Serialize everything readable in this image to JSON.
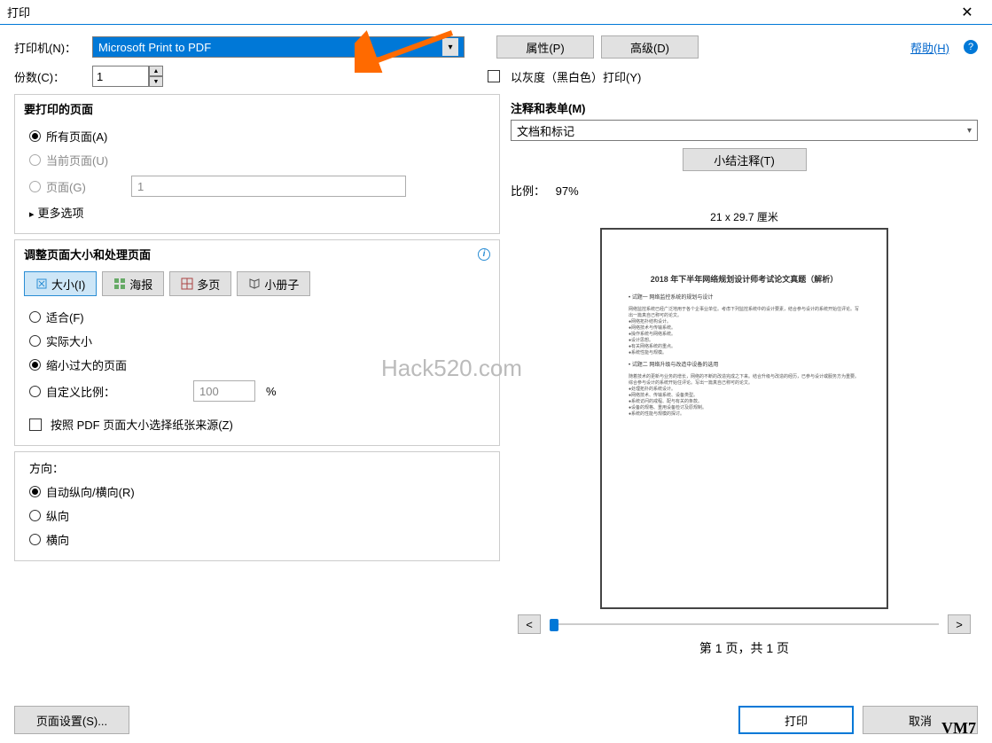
{
  "title": "打印",
  "printer": {
    "label": "打印机(N)：",
    "selected": "Microsoft Print to PDF",
    "properties_btn": "属性(P)",
    "advanced_btn": "高级(D)",
    "help_link": "帮助(H)"
  },
  "copies": {
    "label": "份数(C)：",
    "value": "1",
    "grayscale_label": "以灰度（黑白色）打印(Y)"
  },
  "pages_group": {
    "title": "要打印的页面",
    "all": "所有页面(A)",
    "current": "当前页面(U)",
    "pages": "页面(G)",
    "pages_value": "1",
    "more": "更多选项"
  },
  "sizing_group": {
    "title": "调整页面大小和处理页面",
    "tabs": {
      "size": "大小(I)",
      "poster": "海报",
      "multiple": "多页",
      "booklet": "小册子"
    },
    "fit": "适合(F)",
    "actual": "实际大小",
    "shrink": "缩小过大的页面",
    "custom": "自定义比例：",
    "custom_value": "100",
    "percent": "%",
    "paper_source": "按照 PDF 页面大小选择纸张来源(Z)"
  },
  "orientation_group": {
    "title": "方向：",
    "auto": "自动纵向/横向(R)",
    "portrait": "纵向",
    "landscape": "横向"
  },
  "comments_group": {
    "title": "注释和表单(M)",
    "selected": "文档和标记",
    "summarize_btn": "小结注释(T)"
  },
  "preview": {
    "scale_label": "比例：",
    "scale_value": "97%",
    "dimensions": "21 x 29.7 厘米",
    "doc_title": "2018 年下半年网络规划设计师考试论文真题（解析）",
    "sec1": "• 试题一  网络监控系统的规划与设计",
    "body1": "网络监控系统已经广泛地用于各个企事业单位。考虑下列监控系统中的设计要素，结合参与设计的系统开始住评论。写出一篇真自己称可的论文。",
    "bullets1": [
      "●网络拓扑结构设计。",
      "●网络技术与传输系统。",
      "●操作系统与网络系统。",
      "●设计思想。",
      "●有关网络系统的重点。",
      "●系统性能与规模。"
    ],
    "sec2": "• 试题二  网络升级与改造中设备的选用",
    "body2": "随着技术的更新与业务的增长，网络的不断的改造完成之下来。结合升级与改造的经历，已参与设计或服务方为重要。综合参与设计的系统开始住评论。写出一篇真自己称可的论文。",
    "bullets2": [
      "●处理拓扑的系统设计。",
      "●网络技术、传输系统、设备类型。",
      "●系统访问的戒程、配与有关的条款。",
      "●设备的规格、重用设备检讨及原规制。",
      "●系统的性能与规模的探讨。"
    ],
    "prev": "<",
    "next": ">",
    "page_info": "第 1 页，共 1 页"
  },
  "footer": {
    "page_setup": "页面设置(S)...",
    "print": "打印",
    "cancel": "取消"
  },
  "watermark": "Hack520.com",
  "vm_label": "VM7"
}
